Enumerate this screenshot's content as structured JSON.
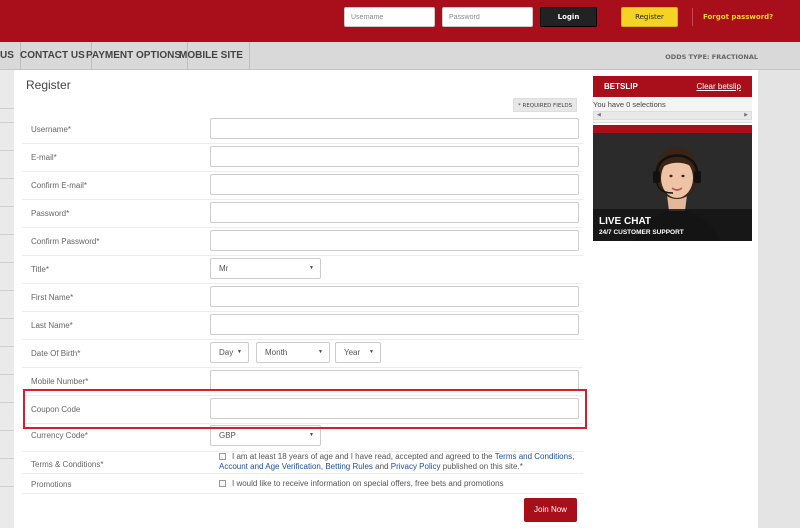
{
  "header": {
    "username_placeholder": "Username",
    "password_placeholder": "Password",
    "login_label": "Login",
    "register_label": "Register",
    "forgot_label": "Forgot password?"
  },
  "nav": {
    "items": [
      "US",
      "CONTACT US",
      "PAYMENT OPTIONS",
      "MOBILE SITE"
    ],
    "odds_type": "ODDS TYPE: FRACTIONAL"
  },
  "form": {
    "title": "Register",
    "required_note": "* REQUIRED FIELDS",
    "labels": {
      "username": "Username*",
      "email": "E-mail*",
      "confirm_email": "Confirm E-mail*",
      "password": "Password*",
      "confirm_password": "Confirm Password*",
      "title": "Title*",
      "first_name": "First Name*",
      "last_name": "Last Name*",
      "dob": "Date Of Birth*",
      "mobile": "Mobile Number*",
      "coupon": "Coupon Code",
      "currency": "Currency Code*",
      "terms": "Terms & Conditions*",
      "promotions": "Promotions"
    },
    "values": {
      "title": "Mr",
      "day": "Day",
      "month": "Month",
      "year": "Year",
      "currency": "GBP"
    },
    "terms_text": {
      "prefix": "I am at least 18 years of age and I have read, accepted and agreed to the",
      "link1": "Terms and Conditions,",
      "link2": "Account and Age Verification,",
      "link3": "Betting Rules",
      "and": "and",
      "link4": "Privacy Policy",
      "suffix": "published on this site.*"
    },
    "promotions_text": "I would like to receive information on special offers, free bets and promotions",
    "join_label": "Join Now"
  },
  "betslip": {
    "title": "BETSLIP",
    "clear_label": "Clear betslip",
    "selections": "You have 0 selections"
  },
  "live_chat": {
    "title": "LIVE CHAT",
    "subtitle": "24/7 CUSTOMER SUPPORT"
  },
  "colors": {
    "brand_red": "#a80f1a",
    "accent_yellow": "#f4d325",
    "highlight_red": "#d5202a"
  }
}
